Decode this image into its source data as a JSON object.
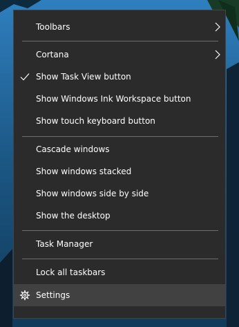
{
  "context_menu": {
    "items": [
      {
        "label": "Toolbars",
        "submenu_arrow": "chevron-right-icon"
      },
      {
        "label": "Cortana",
        "submenu_arrow": "chevron-right-icon"
      },
      {
        "label": "Show Task View button",
        "checked": true,
        "check_icon": "checkmark-icon"
      },
      {
        "label": "Show Windows Ink Workspace button"
      },
      {
        "label": "Show touch keyboard button"
      },
      {
        "label": "Cascade windows"
      },
      {
        "label": "Show windows stacked"
      },
      {
        "label": "Show windows side by side"
      },
      {
        "label": "Show the desktop"
      },
      {
        "label": "Task Manager"
      },
      {
        "label": "Lock all taskbars"
      },
      {
        "label": "Settings",
        "icon": "gear-icon",
        "highlighted": true
      }
    ]
  },
  "colors": {
    "menu_bg": "#2b2b2b",
    "highlight_bg": "#414141",
    "text": "#ffffff",
    "separator": "#6e6e6e",
    "desktop_sky": "#1d4f78"
  }
}
